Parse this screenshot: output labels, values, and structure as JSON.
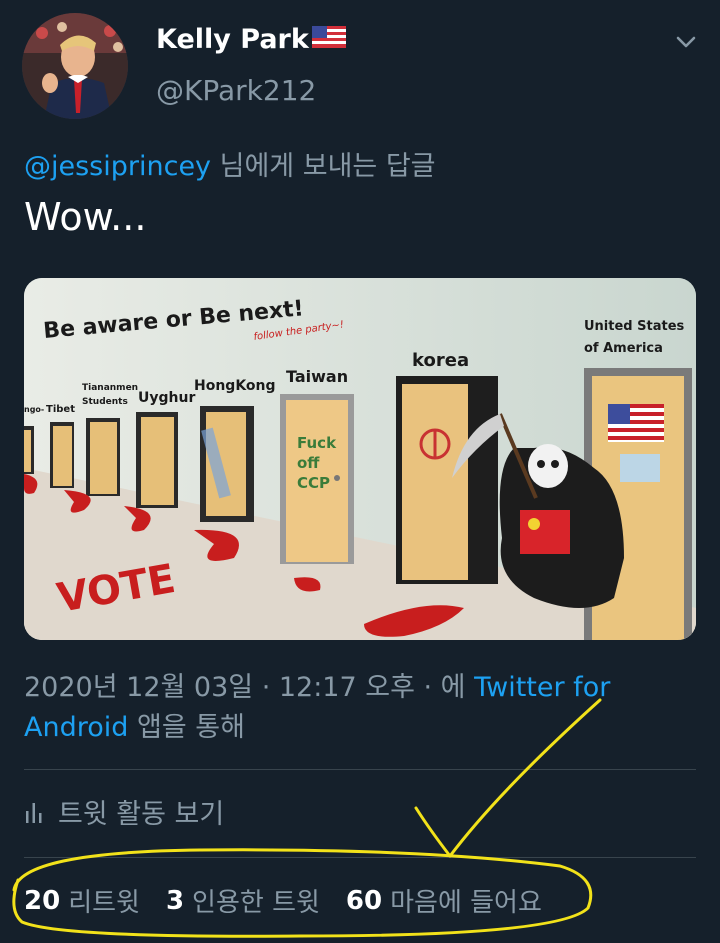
{
  "user": {
    "display_name": "Kelly Park",
    "flag_icon": "us-flag-icon",
    "handle": "@KPark212"
  },
  "reply": {
    "mention": "@jessiprincey",
    "suffix": " 님에게 보내는 답글"
  },
  "tweet": {
    "text": "Wow..."
  },
  "media": {
    "heading": "Be aware or Be next!",
    "subheading": "follow the party~!",
    "door_labels": [
      "ngo-",
      "Tibet",
      "Tiananmen",
      "Students",
      "Uyghur",
      "HongKong",
      "Taiwan",
      "korea",
      "United States",
      "of America"
    ],
    "taiwan_door_text": [
      "Fuck",
      "off",
      "CCP"
    ],
    "floor_text": "VOTE"
  },
  "meta": {
    "timestamp": "2020년 12월 03일 · 12:17 오후 · 에 ",
    "source_link": "Twitter for Android",
    "suffix": " 앱을 통해"
  },
  "activity": {
    "label": "트윗 활동 보기"
  },
  "stats": {
    "retweets_count": "20",
    "retweets_label": "리트윗",
    "quotes_count": "3",
    "quotes_label": "인용한 트윗",
    "likes_count": "60",
    "likes_label": "마음에 들어요"
  },
  "colors": {
    "background": "#15202b",
    "accent": "#1da1f2",
    "secondary_text": "#8899a6",
    "annotation": "#f2e21a"
  }
}
